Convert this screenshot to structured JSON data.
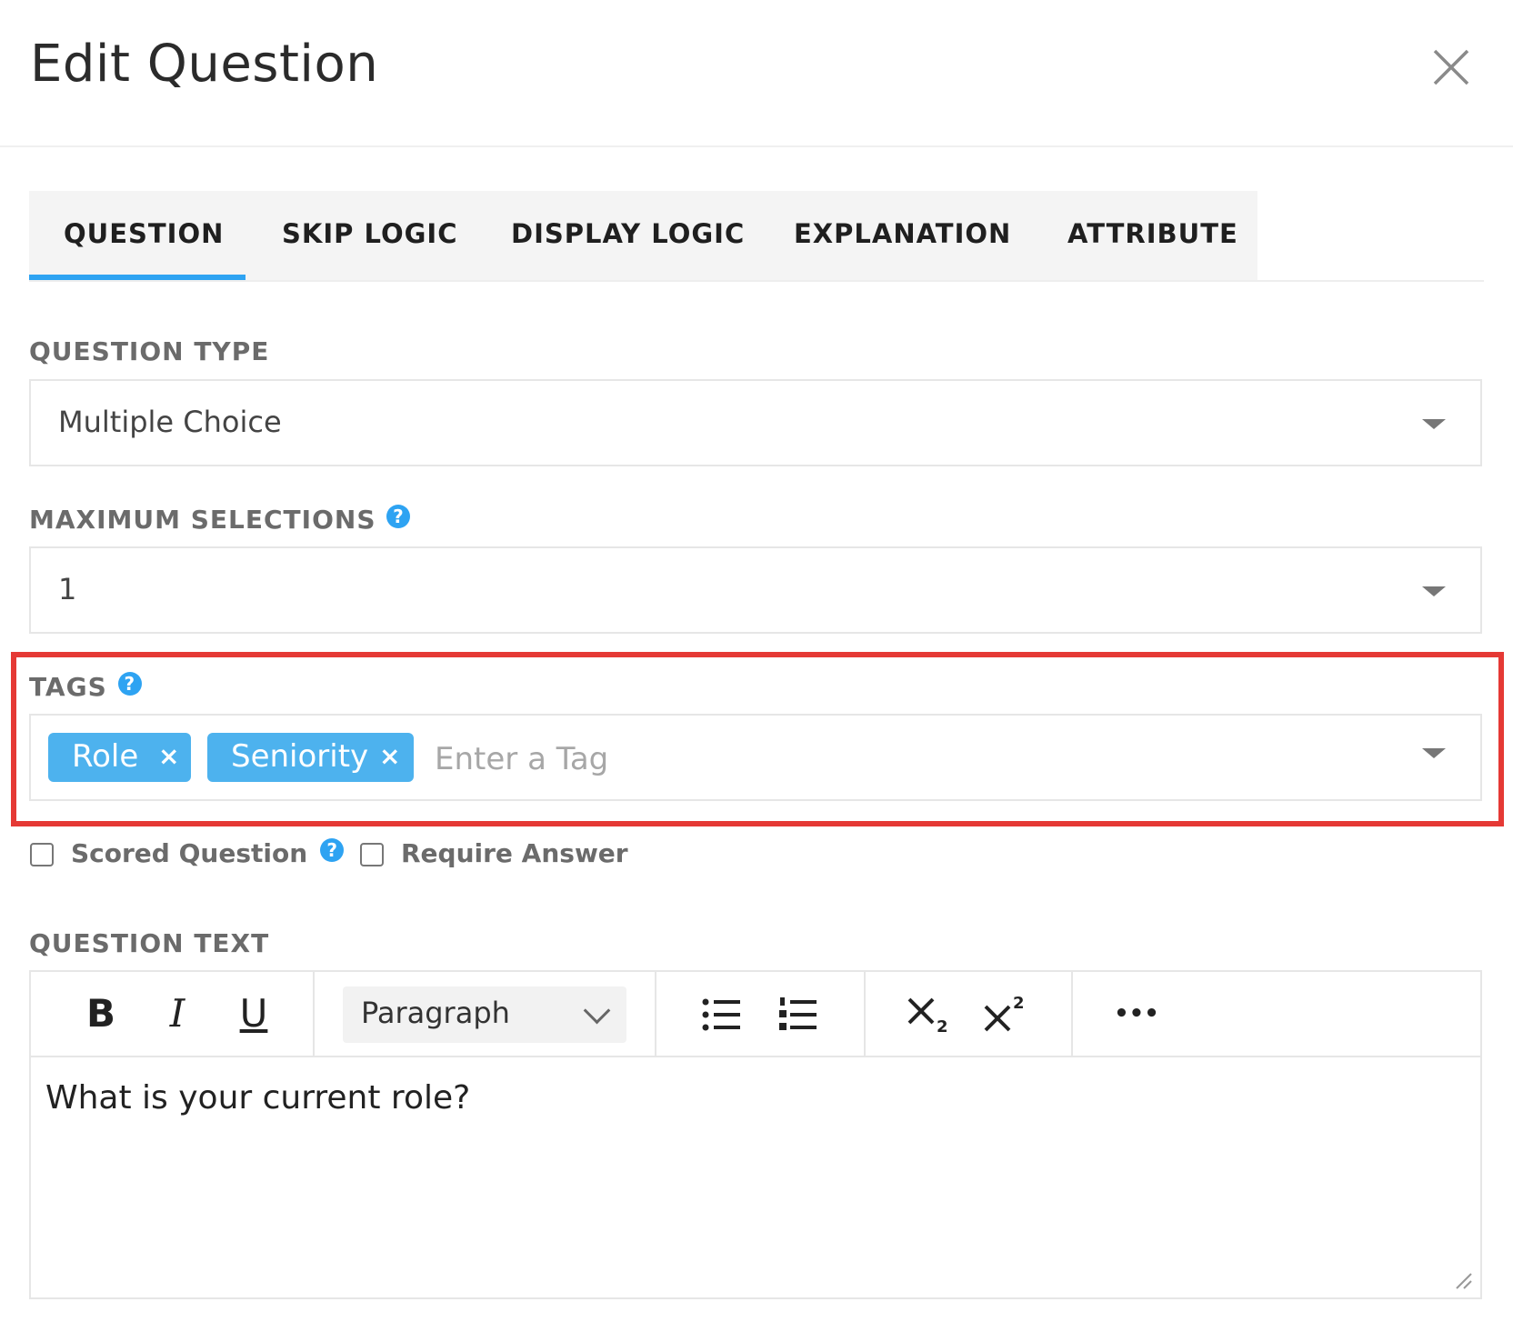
{
  "modal": {
    "title": "Edit Question"
  },
  "tabs": [
    {
      "label": "QUESTION",
      "active": true
    },
    {
      "label": "SKIP LOGIC",
      "active": false
    },
    {
      "label": "DISPLAY LOGIC",
      "active": false
    },
    {
      "label": "EXPLANATION",
      "active": false
    },
    {
      "label": "ATTRIBUTE",
      "active": false
    }
  ],
  "question_type": {
    "label": "QUESTION TYPE",
    "value": "Multiple Choice"
  },
  "max_selections": {
    "label": "MAXIMUM SELECTIONS",
    "value": "1",
    "help_icon": "question-circle-icon"
  },
  "tags": {
    "label": "TAGS",
    "items": [
      {
        "label": "Role",
        "remove": "×"
      },
      {
        "label": "Seniority",
        "remove": "×"
      }
    ],
    "placeholder": "Enter a Tag",
    "highlight_color": "#e53935",
    "chip_color": "#4db2ee"
  },
  "options": {
    "scored": {
      "label": "Scored Question",
      "checked": false
    },
    "require": {
      "label": "Require Answer",
      "checked": false
    }
  },
  "question_text": {
    "label": "QUESTION TEXT",
    "toolbar": {
      "bold": "B",
      "italic": "I",
      "underline": "U",
      "format": "Paragraph",
      "more": "•••"
    },
    "content": "What is your current role?"
  },
  "accent_color": "#2ea3f2"
}
